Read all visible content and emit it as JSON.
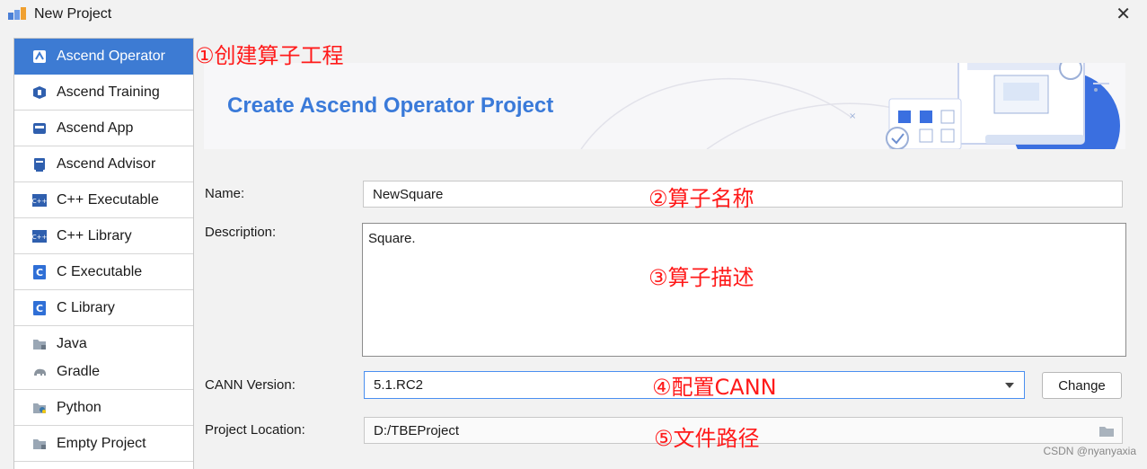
{
  "window": {
    "title": "New Project",
    "close_glyph": "✕"
  },
  "sidebar": {
    "items": [
      {
        "label": "Ascend Operator",
        "icon": "ascend-operator-icon",
        "active": true
      },
      {
        "label": "Ascend Training",
        "icon": "ascend-training-icon"
      },
      {
        "label": "Ascend App",
        "icon": "ascend-app-icon"
      },
      {
        "label": "Ascend Advisor",
        "icon": "ascend-advisor-icon"
      },
      {
        "label": "C++ Executable",
        "icon": "cpp-icon"
      },
      {
        "label": "C++ Library",
        "icon": "cpp-icon"
      },
      {
        "label": "C Executable",
        "icon": "c-icon"
      },
      {
        "label": "C Library",
        "icon": "c-icon"
      },
      {
        "label": "Java",
        "icon": "folder-icon",
        "sub": "Gradle",
        "sub_icon": "gradle-elephant-icon"
      },
      {
        "label": "Python",
        "icon": "python-folder-icon"
      },
      {
        "label": "Empty Project",
        "icon": "folder-icon"
      }
    ]
  },
  "banner": {
    "title": "Create Ascend Operator Project"
  },
  "form": {
    "name_label": "Name:",
    "name_value": "NewSquare",
    "description_label": "Description:",
    "description_value": "Square.",
    "cann_label": "CANN Version:",
    "cann_value": "5.1.RC2",
    "change_button": "Change",
    "location_label": "Project Location:",
    "location_value": "D:/TBEProject"
  },
  "annotations": {
    "a1": "①创建算子工程",
    "a2": "②算子名称",
    "a3": "③算子描述",
    "a4": "④配置CANN",
    "a5": "⑤文件路径"
  },
  "watermark": "CSDN @nyanyaxia",
  "colors": {
    "accent": "#3d7bd3",
    "banner_title": "#3a7ad9",
    "annotation_red": "#ff1a1a"
  }
}
